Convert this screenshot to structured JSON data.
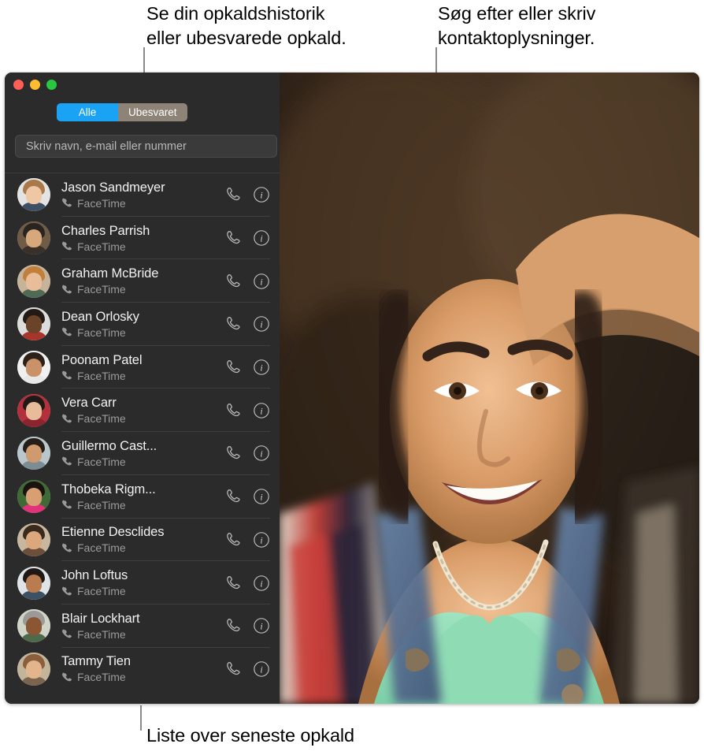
{
  "annotations": {
    "top_left": "Se din opkaldshistorik\neller ubesvarede opkald.",
    "top_right": "Søg efter eller skriv\nkontaktoplysninger.",
    "bottom": "Liste over seneste opkald"
  },
  "window": {
    "traffic_lights": [
      {
        "name": "close",
        "color": "#ff5f57"
      },
      {
        "name": "minimize",
        "color": "#febc2e"
      },
      {
        "name": "zoom",
        "color": "#28c840"
      }
    ]
  },
  "toolbar": {
    "segmented": {
      "selected": "Alle",
      "options": [
        {
          "label": "Alle",
          "active": true
        },
        {
          "label": "Ubesvaret",
          "active": false
        }
      ]
    },
    "search": {
      "value": "",
      "placeholder": "Skriv navn, e-mail eller nummer"
    }
  },
  "colors": {
    "accent": "#1aa3f5",
    "segment_inactive": "#8e8377",
    "window_bg": "#2b2b2b",
    "field_bg": "#3a3a3a",
    "separator": "#3f3f3f",
    "name_text": "#f2f2f2",
    "sub_text": "#9a9a9a",
    "callout_line": "#8a8a8a"
  },
  "call_list": {
    "action_icons": [
      "phone-icon",
      "info-icon"
    ],
    "rows": [
      {
        "name": "Jason Sandmeyer",
        "service": "FaceTime",
        "avatar": {
          "bg": "#e3e3e3",
          "hair": "#a87a4a",
          "skin": "#efc7a5",
          "body": "#3f4f63"
        }
      },
      {
        "name": "Charles Parrish",
        "service": "FaceTime",
        "avatar": {
          "bg": "#6f5b46",
          "hair": "#2a2420",
          "skin": "#d7a87c",
          "body": "#3a3027"
        }
      },
      {
        "name": "Graham McBride",
        "service": "FaceTime",
        "avatar": {
          "bg": "#c6b49a",
          "hair": "#c07f3a",
          "skin": "#e9bd9a",
          "body": "#4f6a55"
        }
      },
      {
        "name": "Dean Orlosky",
        "service": "FaceTime",
        "avatar": {
          "bg": "#dcdcdc",
          "hair": "#231a16",
          "skin": "#6b4329",
          "body": "#a8342c"
        }
      },
      {
        "name": "Poonam Patel",
        "service": "FaceTime",
        "avatar": {
          "bg": "#f0f0f0",
          "hair": "#2c2018",
          "skin": "#c99268",
          "body": "#e8e8e8"
        }
      },
      {
        "name": "Vera Carr",
        "service": "FaceTime",
        "avatar": {
          "bg": "#b2313c",
          "hair": "#1f1a18",
          "skin": "#e8bc9a",
          "body": "#8c2430"
        }
      },
      {
        "name": "Guillermo Cast...",
        "service": "FaceTime",
        "avatar": {
          "bg": "#b9c6cc",
          "hair": "#241d18",
          "skin": "#cf9a6d",
          "body": "#7d8d94"
        }
      },
      {
        "name": "Thobeka Rigm...",
        "service": "FaceTime",
        "avatar": {
          "bg": "#3f6a36",
          "hair": "#191210",
          "skin": "#d8a072",
          "body": "#e0337a"
        }
      },
      {
        "name": "Etienne Desclides",
        "service": "FaceTime",
        "avatar": {
          "bg": "#c7b79f",
          "hair": "#3a2a1d",
          "skin": "#dba87e",
          "body": "#6b4f3a"
        }
      },
      {
        "name": "John Loftus",
        "service": "FaceTime",
        "avatar": {
          "bg": "#dfe4e8",
          "hair": "#201815",
          "skin": "#b87c50",
          "body": "#3d5164"
        }
      },
      {
        "name": "Blair Lockhart",
        "service": "FaceTime",
        "avatar": {
          "bg": "#cfd6c8",
          "hair": "#9b9a98",
          "skin": "#8a5634",
          "body": "#4f6a4a"
        }
      },
      {
        "name": "Tammy Tien",
        "service": "FaceTime",
        "avatar": {
          "bg": "#c3b49c",
          "hair": "#8b5e3c",
          "skin": "#e2b58c",
          "body": "#7a6450"
        }
      }
    ]
  }
}
